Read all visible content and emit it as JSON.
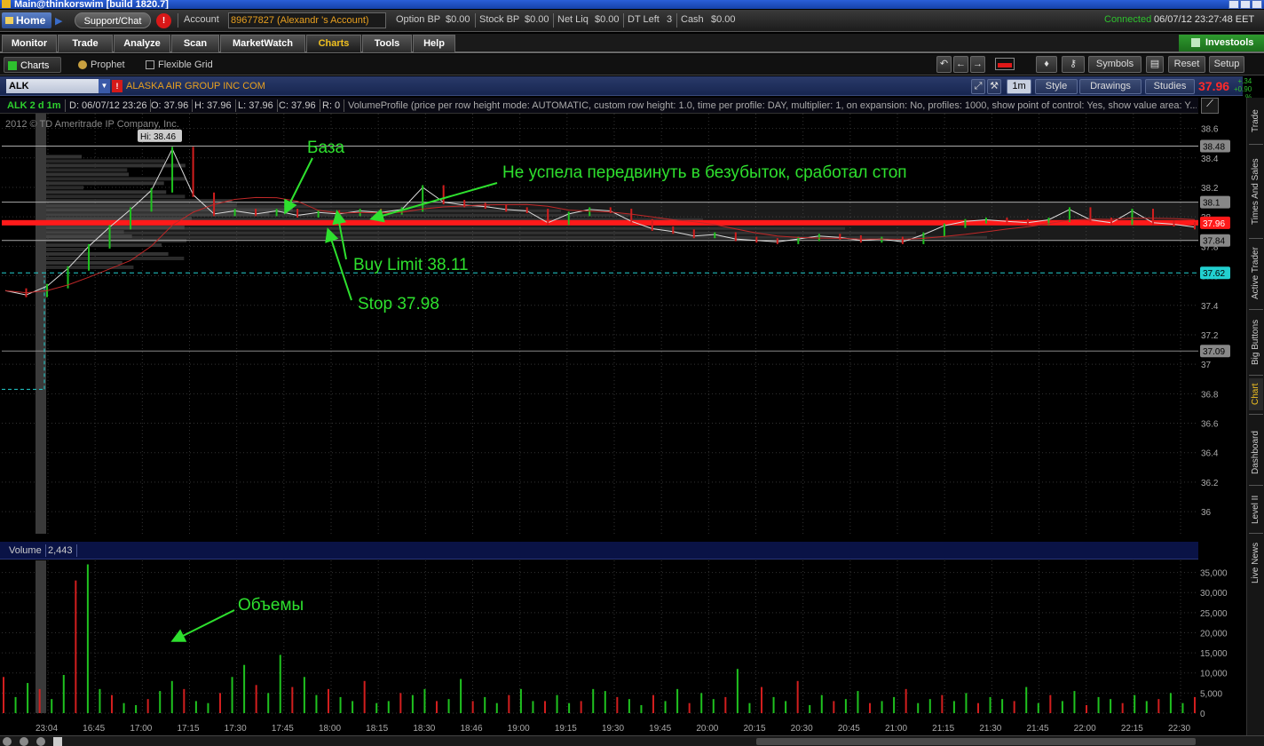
{
  "window": {
    "title": "Main@thinkorswim [build 1820.7]"
  },
  "account_bar": {
    "home_label": "Home",
    "support_label": "Support/Chat",
    "alert_label": "!",
    "account_label": "Account",
    "account_value": "89677827 (Alexandr 's Account)",
    "items": [
      {
        "label": "Option BP",
        "value": "$0.00"
      },
      {
        "label": "Stock BP",
        "value": "$0.00"
      },
      {
        "label": "Net Liq",
        "value": "$0.00"
      },
      {
        "label": "DT Left",
        "value": "3"
      },
      {
        "label": "Cash",
        "value": "$0.00"
      }
    ],
    "status": "Connected",
    "datetime": "06/07/12 23:27:48 EET"
  },
  "main_tabs": [
    "Monitor",
    "Trade",
    "Analyze",
    "Scan",
    "MarketWatch",
    "Charts",
    "Tools",
    "Help"
  ],
  "active_tab": "Charts",
  "investools_label": "Investools",
  "sub_tabs": [
    "Charts",
    "Prophet",
    "Flexible Grid"
  ],
  "toolbar": {
    "symbols": "Symbols",
    "reset": "Reset",
    "setup": "Setup",
    "undo": "↶",
    "back": "←",
    "forward": "→"
  },
  "symbol_bar": {
    "symbol": "ALK",
    "company": "ALASKA AIR GROUP INC COM",
    "aggregation": "1m",
    "style": "Style",
    "drawings": "Drawings",
    "studies": "Studies",
    "last": "37.96",
    "change": "+.34",
    "change_pct": "+0.90 %"
  },
  "study_header": {
    "symbol_period": "ALK 2 d 1m",
    "date": "D: 06/07/12 23:26",
    "open": "O: 37.96",
    "high": "H: 37.96",
    "low": "L: 37.96",
    "close": "C: 37.96",
    "range": "R: 0",
    "volume_profile": "VolumeProfile (price per row height mode: AUTOMATIC, custom row height: 1.0, time per profile: DAY, multiplier: 1, on expansion: No, profiles: 1000, show point of control: Yes, show value area: Y..."
  },
  "copyright": "2012 © TD Ameritrade IP Company, Inc.",
  "volume_header": {
    "label": "Volume",
    "value": "2,443"
  },
  "right_tabs": [
    "Trade",
    "Times And Sales",
    "Active Trader",
    "Big Buttons",
    "Chart",
    "Dashboard",
    "Level II",
    "Live News"
  ],
  "active_right_tab": "Chart",
  "colors": {
    "up": "#1fc21f",
    "down": "#d21e1e",
    "price_line": "#ff1a1a",
    "annotation": "#2ee02e",
    "dashed": "#22d0d0"
  },
  "chart_data": [
    {
      "type": "line",
      "title": "ALK 2 d 1m",
      "xlabel": "",
      "ylabel": "",
      "ylim": [
        35.85,
        38.7
      ],
      "y_ticks": [
        "38.6",
        "38.4",
        "38.2",
        "38",
        "37.8",
        "37.6",
        "37.4",
        "37.2",
        "37",
        "36.8",
        "36.6",
        "36.4",
        "36.2",
        "36"
      ],
      "x_ticks": [
        "23:04",
        "16:45",
        "17:00",
        "17:15",
        "17:30",
        "17:45",
        "18:00",
        "18:15",
        "18:30",
        "18:46",
        "19:00",
        "19:15",
        "19:30",
        "19:45",
        "20:00",
        "20:15",
        "20:30",
        "20:45",
        "21:00",
        "21:15",
        "21:30",
        "21:45",
        "22:00",
        "22:15",
        "22:30"
      ],
      "series": [
        {
          "values": [
            37.5,
            37.47,
            37.53,
            37.65,
            37.8,
            37.93,
            38.05,
            38.18,
            38.46,
            38.15,
            38.02,
            38.04,
            38.02,
            38.04,
            38.01,
            38.03,
            38.02,
            38.04,
            38.03,
            38.05,
            38.2,
            38.1,
            38.08,
            38.07,
            38.05,
            38.04,
            37.96,
            38.02,
            38.05,
            38.04,
            37.97,
            37.92,
            37.9,
            37.87,
            37.88,
            37.85,
            37.84,
            37.83,
            37.85,
            37.87,
            37.86,
            37.84,
            37.85,
            37.83,
            37.88,
            37.94,
            37.97,
            37.98,
            37.97,
            37.96,
            37.98,
            38.05,
            37.98,
            37.96,
            38.04,
            37.96,
            37.95,
            37.93
          ]
        }
      ],
      "price_labels": [
        "38.48",
        "38.1",
        "37.96",
        "37.84",
        "37.62",
        "37.09"
      ],
      "hi_label": "Hi: 38.46",
      "annotations": [
        "База",
        "Не успела передвинуть в  безубыток, сработал  стоп",
        "Buy Limit 38.11",
        "Stop 37.98"
      ],
      "grid": true
    },
    {
      "type": "bar",
      "title": "Volume",
      "xlabel": "",
      "ylabel": "",
      "ylim": [
        0,
        38000
      ],
      "y_ticks": [
        "35,000",
        "30,000",
        "25,000",
        "20,000",
        "15,000",
        "10,000",
        "5,000",
        "0"
      ],
      "values": [
        9000,
        4000,
        7500,
        6000,
        3500,
        9500,
        33000,
        37000,
        6000,
        4500,
        2500,
        2000,
        3500,
        5500,
        8000,
        6000,
        3000,
        2500,
        5000,
        9000,
        12000,
        7000,
        5000,
        14500,
        6500,
        9000,
        4500,
        6000,
        4000,
        3000,
        8000,
        2500,
        3000,
        5000,
        4500,
        6000,
        3000,
        3500,
        8500,
        3000,
        4000,
        2500,
        4500,
        6000,
        3000,
        3000,
        4500,
        2500,
        3000,
        6000,
        5500,
        4000,
        3500,
        2000,
        4500,
        3000,
        6000,
        2500,
        5000,
        3500,
        4000,
        11000,
        2500,
        6500,
        4000,
        3000,
        8000,
        2000,
        4500,
        3000,
        3500,
        5500,
        2500,
        3000,
        4000,
        6000,
        2500,
        3500,
        4500,
        3000,
        5000,
        2500,
        4000,
        3500,
        3000,
        6500,
        2500,
        4500,
        3000,
        5500,
        2000,
        4000,
        3500,
        2500,
        4500,
        3000,
        3500,
        5000,
        2500,
        4000
      ],
      "annotation": "Объемы",
      "grid": true
    }
  ]
}
